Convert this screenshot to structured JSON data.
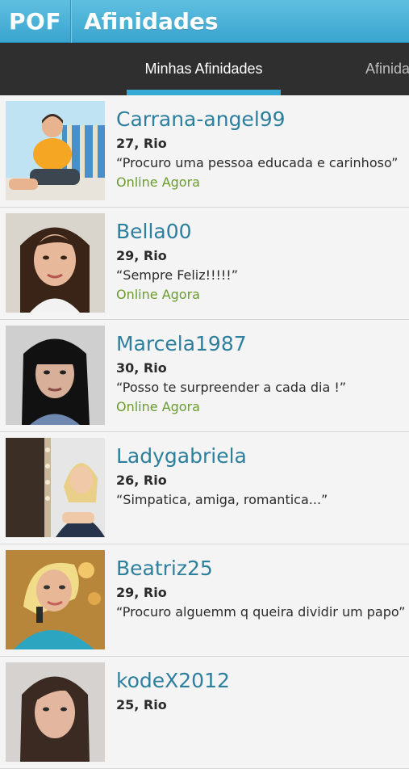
{
  "app": {
    "logo": "POF",
    "title": "Afinidades"
  },
  "tabs": {
    "active": "Minhas Afinidades",
    "next": "Afinida"
  },
  "profiles": [
    {
      "username": "Carrana-angel99",
      "meta": "27, Rio",
      "quote": "“Procuro uma pessoa educada e carinhoso”",
      "status": "Online Agora"
    },
    {
      "username": "Bella00",
      "meta": "29, Rio",
      "quote": "“Sempre Feliz!!!!!”",
      "status": "Online Agora"
    },
    {
      "username": "Marcela1987",
      "meta": "30, Rio",
      "quote": "“Posso te surpreender a cada dia !”",
      "status": "Online Agora"
    },
    {
      "username": "Ladygabriela",
      "meta": "26, Rio",
      "quote": "“Simpatica, amiga, romantica...”",
      "status": ""
    },
    {
      "username": "Beatriz25",
      "meta": "29, Rio",
      "quote": "“Procuro alguemm q queira dividir um papo”",
      "status": ""
    },
    {
      "username": "kodeX2012",
      "meta": "25, Rio",
      "quote": "",
      "status": ""
    }
  ]
}
